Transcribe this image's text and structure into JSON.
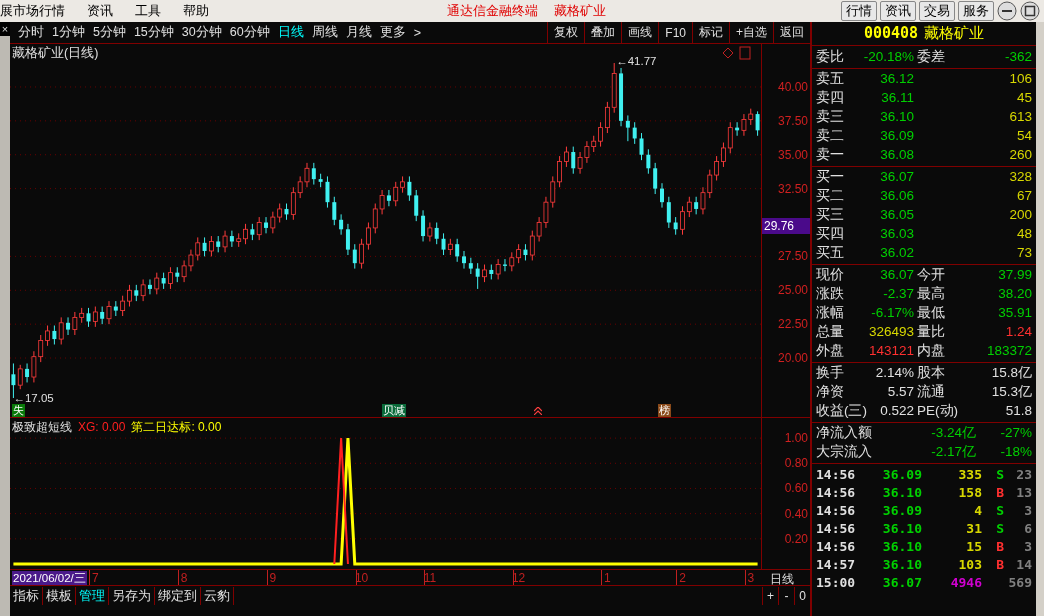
{
  "menu_bar": {
    "items": [
      "展市场行情",
      "资讯",
      "工具",
      "帮助"
    ],
    "app_title": "通达信金融终端",
    "stock_title": "藏格矿业",
    "buttons": [
      "行情",
      "资讯",
      "交易",
      "服务"
    ]
  },
  "close_mark": "×",
  "period_tabs": [
    {
      "label": "分时",
      "selected": false
    },
    {
      "label": "1分钟",
      "selected": false
    },
    {
      "label": "5分钟",
      "selected": false
    },
    {
      "label": "15分钟",
      "selected": false
    },
    {
      "label": "30分钟",
      "selected": false
    },
    {
      "label": "60分钟",
      "selected": false
    },
    {
      "label": "日线",
      "selected": true
    },
    {
      "label": "周线",
      "selected": false
    },
    {
      "label": "月线",
      "selected": false
    },
    {
      "label": "更多",
      "selected": false
    }
  ],
  "more_arrow": ">",
  "tool_buttons": [
    "复权",
    "叠加",
    "画线",
    "F10",
    "标记",
    "+自选",
    "返回"
  ],
  "main_chart": {
    "title": "藏格矿业(日线)",
    "high_label": "←41.77",
    "low_label": "←17.05",
    "current_price": "29.76",
    "event_tags": [
      {
        "kind": "badge",
        "text": "失",
        "color": "#0a7a0a"
      },
      {
        "kind": "badge",
        "text": "贝减",
        "color": "#0a6a3a"
      },
      {
        "kind": "arrow"
      },
      {
        "kind": "badge",
        "text": "榜",
        "color": "#8a4a1a"
      }
    ],
    "chart_data": {
      "type": "candlestick",
      "ylim": [
        15.65,
        43.17
      ],
      "yticks": [
        {
          "value": 40,
          "label": "40.00"
        },
        {
          "value": 37.5,
          "label": "37.50"
        },
        {
          "value": 35,
          "label": "35.00"
        },
        {
          "value": 32.5,
          "label": "32.50"
        },
        {
          "value": 27.5,
          "label": "27.50"
        },
        {
          "value": 25,
          "label": "25.00"
        },
        {
          "value": 22.5,
          "label": "22.50"
        },
        {
          "value": 20,
          "label": "20.00"
        }
      ],
      "grid": true,
      "categories": [
        null,
        null,
        null,
        null,
        null,
        null,
        null,
        null,
        null,
        null,
        null,
        null,
        null,
        null,
        null,
        null,
        null,
        null,
        null,
        null,
        null,
        null,
        null,
        null,
        null,
        null,
        null,
        null,
        null,
        null,
        null,
        null,
        null,
        null,
        null,
        null,
        null,
        null,
        null,
        null,
        null,
        null,
        null,
        null,
        null,
        null,
        null,
        null,
        null,
        null,
        null,
        null,
        null,
        null,
        null,
        null,
        null,
        null,
        null,
        null,
        null,
        null,
        null,
        null,
        null,
        null,
        null,
        null,
        null,
        null,
        null,
        null,
        null,
        null,
        null,
        null,
        null,
        null,
        null,
        null,
        null,
        null,
        null,
        null,
        null,
        null,
        null,
        null,
        null,
        null,
        null,
        null,
        null,
        null,
        null,
        null,
        null,
        null,
        null,
        null,
        null,
        null,
        null,
        null,
        null,
        null,
        null,
        null,
        null,
        null
      ],
      "ohlc": [
        [
          18.8,
          19.6,
          17.05,
          18.0
        ],
        [
          18.0,
          19.5,
          17.7,
          19.2
        ],
        [
          19.2,
          19.6,
          18.2,
          18.6
        ],
        [
          18.6,
          20.5,
          18.2,
          20.1
        ],
        [
          20.1,
          21.7,
          19.7,
          21.3
        ],
        [
          21.3,
          22.4,
          20.9,
          22.0
        ],
        [
          22.0,
          22.4,
          21.0,
          21.4
        ],
        [
          21.4,
          23.0,
          21.0,
          22.6
        ],
        [
          22.6,
          23.0,
          21.7,
          22.1
        ],
        [
          22.1,
          23.4,
          21.7,
          23.0
        ],
        [
          23.0,
          23.7,
          22.6,
          23.3
        ],
        [
          23.3,
          23.7,
          22.3,
          22.7
        ],
        [
          22.7,
          23.8,
          22.3,
          23.4
        ],
        [
          23.4,
          23.8,
          22.5,
          22.9
        ],
        [
          22.9,
          24.2,
          22.5,
          23.8
        ],
        [
          23.8,
          24.2,
          23.1,
          23.5
        ],
        [
          23.5,
          24.6,
          23.1,
          24.2
        ],
        [
          24.2,
          25.4,
          23.8,
          25.0
        ],
        [
          25.0,
          25.4,
          24.2,
          24.6
        ],
        [
          24.6,
          25.8,
          24.2,
          25.4
        ],
        [
          25.4,
          25.8,
          24.7,
          25.1
        ],
        [
          25.1,
          26.3,
          24.7,
          25.9
        ],
        [
          25.9,
          26.3,
          25.1,
          25.5
        ],
        [
          25.5,
          26.7,
          25.1,
          26.3
        ],
        [
          26.3,
          26.7,
          25.6,
          26.0
        ],
        [
          26.0,
          27.2,
          25.6,
          26.8
        ],
        [
          26.8,
          28.0,
          26.4,
          27.6
        ],
        [
          27.6,
          28.9,
          27.2,
          28.5
        ],
        [
          28.5,
          28.9,
          27.5,
          27.9
        ],
        [
          27.9,
          29.0,
          27.5,
          28.6
        ],
        [
          28.6,
          29.0,
          27.8,
          28.2
        ],
        [
          28.2,
          29.4,
          27.8,
          29.0
        ],
        [
          29.0,
          29.4,
          28.2,
          28.6
        ],
        [
          28.6,
          29.2,
          28.2,
          28.8
        ],
        [
          28.8,
          29.9,
          28.4,
          29.5
        ],
        [
          29.5,
          29.9,
          28.7,
          29.1
        ],
        [
          29.1,
          30.4,
          28.7,
          30.0
        ],
        [
          30.0,
          30.4,
          29.2,
          29.6
        ],
        [
          29.6,
          30.8,
          29.2,
          30.4
        ],
        [
          30.4,
          31.4,
          30.0,
          31.0
        ],
        [
          31.0,
          31.4,
          30.2,
          30.6
        ],
        [
          30.6,
          32.6,
          30.2,
          32.2
        ],
        [
          32.2,
          33.4,
          31.8,
          33.0
        ],
        [
          33.0,
          34.4,
          32.6,
          34.0
        ],
        [
          34.0,
          34.4,
          32.8,
          33.2
        ],
        [
          33.2,
          33.6,
          32.6,
          33.0
        ],
        [
          33.0,
          33.4,
          31.1,
          31.5
        ],
        [
          31.5,
          31.9,
          29.8,
          30.2
        ],
        [
          30.2,
          30.6,
          29.1,
          29.5
        ],
        [
          29.5,
          29.9,
          27.6,
          28.0
        ],
        [
          28.0,
          28.4,
          26.6,
          27.0
        ],
        [
          27.0,
          28.8,
          26.6,
          28.4
        ],
        [
          28.4,
          30.0,
          28.0,
          29.6
        ],
        [
          29.6,
          31.4,
          29.2,
          31.0
        ],
        [
          31.0,
          32.4,
          30.6,
          32.0
        ],
        [
          32.0,
          32.4,
          31.2,
          31.6
        ],
        [
          31.6,
          33.0,
          31.2,
          32.6
        ],
        [
          32.6,
          33.4,
          32.2,
          33.0
        ],
        [
          33.0,
          33.4,
          31.6,
          32.0
        ],
        [
          32.0,
          32.4,
          30.1,
          30.5
        ],
        [
          30.5,
          30.9,
          28.6,
          29.0
        ],
        [
          29.0,
          30.0,
          28.6,
          29.6
        ],
        [
          29.6,
          30.0,
          28.4,
          28.8
        ],
        [
          28.8,
          29.2,
          27.6,
          28.0
        ],
        [
          28.0,
          28.8,
          27.6,
          28.4
        ],
        [
          28.4,
          28.8,
          27.1,
          27.5
        ],
        [
          27.5,
          27.9,
          26.6,
          27.0
        ],
        [
          27.0,
          27.4,
          26.2,
          26.6
        ],
        [
          26.6,
          27.0,
          25.1,
          26.0
        ],
        [
          26.0,
          26.9,
          25.6,
          26.5
        ],
        [
          26.5,
          26.9,
          25.8,
          26.2
        ],
        [
          26.2,
          27.3,
          25.8,
          26.9
        ],
        [
          26.9,
          27.3,
          26.4,
          26.8
        ],
        [
          26.8,
          27.8,
          26.4,
          27.4
        ],
        [
          27.4,
          28.4,
          27.0,
          28.0
        ],
        [
          28.0,
          28.4,
          27.2,
          27.6
        ],
        [
          27.6,
          29.4,
          27.2,
          29.0
        ],
        [
          29.0,
          30.4,
          28.6,
          30.0
        ],
        [
          30.0,
          31.9,
          29.6,
          31.5
        ],
        [
          31.5,
          33.4,
          31.1,
          33.0
        ],
        [
          33.0,
          34.9,
          32.6,
          34.5
        ],
        [
          34.5,
          35.6,
          34.1,
          35.2
        ],
        [
          35.2,
          35.6,
          33.6,
          34.0
        ],
        [
          34.0,
          35.2,
          33.6,
          34.8
        ],
        [
          34.8,
          36.0,
          34.4,
          35.6
        ],
        [
          35.6,
          36.4,
          35.2,
          36.0
        ],
        [
          36.0,
          37.4,
          35.6,
          37.0
        ],
        [
          37.0,
          38.9,
          36.6,
          38.5
        ],
        [
          38.5,
          41.77,
          38.1,
          41.0
        ],
        [
          41.0,
          41.4,
          37.1,
          37.5
        ],
        [
          37.5,
          37.9,
          36.0,
          37.0
        ],
        [
          37.0,
          37.4,
          35.8,
          36.2
        ],
        [
          36.2,
          36.6,
          34.6,
          35.0
        ],
        [
          35.0,
          35.4,
          33.6,
          34.0
        ],
        [
          34.0,
          34.4,
          32.1,
          32.5
        ],
        [
          32.5,
          32.9,
          31.1,
          31.5
        ],
        [
          31.5,
          31.9,
          29.6,
          30.0
        ],
        [
          30.0,
          30.4,
          29.1,
          29.5
        ],
        [
          29.5,
          31.2,
          29.1,
          30.8
        ],
        [
          30.8,
          31.9,
          30.4,
          31.5
        ],
        [
          31.5,
          31.9,
          30.6,
          31.0
        ],
        [
          31.0,
          32.6,
          30.6,
          32.2
        ],
        [
          32.2,
          33.9,
          31.8,
          33.5
        ],
        [
          33.5,
          34.9,
          33.1,
          34.5
        ],
        [
          34.5,
          35.9,
          34.1,
          35.5
        ],
        [
          35.5,
          37.4,
          35.1,
          37.0
        ],
        [
          37.0,
          37.4,
          36.4,
          36.8
        ],
        [
          36.8,
          38.0,
          36.4,
          37.6
        ],
        [
          37.6,
          38.4,
          37.2,
          38.0
        ],
        [
          38.0,
          38.2,
          36.4,
          36.8
        ]
      ]
    }
  },
  "indicator": {
    "name": "极致超短线",
    "readings": [
      ": 0.00",
      ": 0.00"
    ],
    "chart_data": {
      "type": "line",
      "ylim": [
        -0.04,
        1.16
      ],
      "yticks": [
        {
          "value": 1,
          "label": "1.00"
        },
        {
          "value": 0.8,
          "label": "0.80"
        },
        {
          "value": 0.6,
          "label": "0.60"
        },
        {
          "value": 0.4,
          "label": "0.40"
        },
        {
          "value": 0.2,
          "label": "0.20"
        }
      ],
      "grid": true,
      "categories": [
        null,
        null,
        null,
        null,
        null,
        null,
        null,
        null,
        null,
        null,
        null,
        null,
        "7",
        null,
        null,
        null,
        null,
        null,
        null,
        null,
        null,
        null,
        null,
        null,
        null,
        "8",
        null,
        null,
        null,
        null,
        null,
        null,
        null,
        null,
        null,
        null,
        null,
        null,
        "9",
        null,
        null,
        null,
        null,
        null,
        null,
        null,
        null,
        null,
        null,
        null,
        null,
        "10",
        null,
        null,
        null,
        null,
        null,
        null,
        null,
        null,
        null,
        "11",
        null,
        null,
        null,
        null,
        null,
        null,
        null,
        null,
        null,
        null,
        null,
        null,
        "12",
        null,
        null,
        null,
        null,
        null,
        null,
        null,
        null,
        null,
        null,
        null,
        null,
        "1",
        null,
        null,
        null,
        null,
        null,
        null,
        null,
        null,
        null,
        null,
        "2",
        null,
        null,
        null,
        null,
        null,
        null,
        null,
        null,
        null,
        "3",
        null
      ],
      "series": [
        {
          "name": "XG",
          "color": "#ff2020",
          "values": [
            null,
            null,
            null,
            null,
            null,
            null,
            null,
            null,
            null,
            null,
            null,
            null,
            null,
            null,
            null,
            null,
            null,
            null,
            null,
            null,
            null,
            null,
            null,
            null,
            null,
            null,
            null,
            null,
            null,
            null,
            null,
            null,
            null,
            null,
            null,
            null,
            null,
            null,
            null,
            null,
            null,
            null,
            null,
            null,
            null,
            null,
            null,
            0,
            1,
            0,
            null,
            null,
            null,
            null,
            null,
            null,
            null,
            null,
            null,
            null,
            null,
            null,
            null,
            null,
            null,
            null,
            null,
            null,
            null,
            null,
            null,
            null,
            null,
            null,
            null,
            null,
            null,
            null,
            null,
            null,
            null,
            null,
            null,
            null,
            null,
            null,
            null,
            null,
            null,
            null,
            null,
            null,
            null,
            null,
            null,
            null,
            null,
            null,
            null,
            null,
            null,
            null,
            null,
            null,
            null,
            null,
            null,
            null,
            null,
            null
          ]
        },
        {
          "name": "第二日达标",
          "color": "#ffff00",
          "values": [
            0,
            0,
            0,
            0,
            0,
            0,
            0,
            0,
            0,
            0,
            0,
            0,
            0,
            0,
            0,
            0,
            0,
            0,
            0,
            0,
            0,
            0,
            0,
            0,
            0,
            0,
            0,
            0,
            0,
            0,
            0,
            0,
            0,
            0,
            0,
            0,
            0,
            0,
            0,
            0,
            0,
            0,
            0,
            0,
            0,
            0,
            0,
            0,
            0,
            1,
            0,
            0,
            0,
            0,
            0,
            0,
            0,
            0,
            0,
            0,
            0,
            0,
            0,
            0,
            0,
            0,
            0,
            0,
            0,
            0,
            0,
            0,
            0,
            0,
            0,
            0,
            0,
            0,
            0,
            0,
            0,
            0,
            0,
            0,
            0,
            0,
            0,
            0,
            0,
            0,
            0,
            0,
            0,
            0,
            0,
            0,
            0,
            0,
            0,
            0,
            0,
            0,
            0,
            0,
            0,
            0,
            0,
            0,
            0,
            0
          ]
        }
      ]
    }
  },
  "date_axis": {
    "cursor_date": "2021/06/02/三",
    "period": "日线"
  },
  "bottom_tabs": [
    {
      "label": "指标",
      "selected": false
    },
    {
      "label": "模板",
      "selected": false
    },
    {
      "label": "管理",
      "selected": true
    },
    {
      "label": "另存为",
      "selected": false
    },
    {
      "label": "绑定到",
      "selected": false
    },
    {
      "label": "云豹",
      "selected": false
    }
  ],
  "zoom_buttons": [
    "+",
    "-",
    "0"
  ],
  "quote": {
    "code": "000408",
    "name": "藏格矿业",
    "ratio": {
      "label": "委比",
      "value": "-20.18%",
      "label2": "委差",
      "value2": "-362"
    },
    "asks": [
      {
        "label": "卖五",
        "price": "36.12",
        "volume": "106"
      },
      {
        "label": "卖四",
        "price": "36.11",
        "volume": "45"
      },
      {
        "label": "卖三",
        "price": "36.10",
        "volume": "613"
      },
      {
        "label": "卖二",
        "price": "36.09",
        "volume": "54"
      },
      {
        "label": "卖一",
        "price": "36.08",
        "volume": "260"
      }
    ],
    "bids": [
      {
        "label": "买一",
        "price": "36.07",
        "volume": "328"
      },
      {
        "label": "买二",
        "price": "36.06",
        "volume": "67"
      },
      {
        "label": "买三",
        "price": "36.05",
        "volume": "200"
      },
      {
        "label": "买四",
        "price": "36.03",
        "volume": "48"
      },
      {
        "label": "买五",
        "price": "36.02",
        "volume": "73"
      }
    ],
    "stats": [
      {
        "cells": [
          {
            "label": "现价",
            "value": "36.07",
            "color": "#00d000"
          },
          {
            "label": "今开",
            "value": "37.99",
            "color": "#00d000"
          }
        ]
      },
      {
        "cells": [
          {
            "label": "涨跌",
            "value": "-2.37",
            "color": "#00d000"
          },
          {
            "label": "最高",
            "value": "38.20",
            "color": "#00d000"
          }
        ]
      },
      {
        "cells": [
          {
            "label": "涨幅",
            "value": "-6.17%",
            "color": "#00d000"
          },
          {
            "label": "最低",
            "value": "35.91",
            "color": "#00d000"
          }
        ]
      },
      {
        "cells": [
          {
            "label": "总量",
            "value": "326493",
            "color": "#d8d800"
          },
          {
            "label": "量比",
            "value": "1.24",
            "color": "#ff3030"
          }
        ]
      },
      {
        "cells": [
          {
            "label": "外盘",
            "value": "143121",
            "color": "#ff3030"
          },
          {
            "label": "内盘",
            "value": "183372",
            "color": "#00d000"
          }
        ]
      }
    ],
    "fundamentals": [
      {
        "label": "换手",
        "value": "2.14%",
        "label2": "股本",
        "value2": "15.8亿"
      },
      {
        "label": "净资",
        "value": "5.57",
        "label2": "流通",
        "value2": "15.3亿"
      },
      {
        "label": "收益(三)",
        "value": "0.522",
        "label2": "PE(动)",
        "value2": "51.8"
      }
    ],
    "flows": [
      {
        "label": "净流入额",
        "amount": "-3.24亿",
        "percent": "-27%"
      },
      {
        "label": "大宗流入",
        "amount": "-2.17亿",
        "percent": "-18%"
      }
    ],
    "trades": [
      {
        "kind": "sell",
        "time": "14:56",
        "price": "36.09",
        "volume": "335",
        "side": "S",
        "count": "23"
      },
      {
        "kind": "buy",
        "time": "14:56",
        "price": "36.10",
        "volume": "158",
        "side": "B",
        "count": "13"
      },
      {
        "kind": "sell",
        "time": "14:56",
        "price": "36.09",
        "volume": "4",
        "side": "S",
        "count": "3"
      },
      {
        "kind": "sell",
        "time": "14:56",
        "price": "36.10",
        "volume": "31",
        "side": "S",
        "count": "6"
      },
      {
        "kind": "buy",
        "time": "14:56",
        "price": "36.10",
        "volume": "15",
        "side": "B",
        "count": "3"
      },
      {
        "kind": "buy",
        "time": "14:57",
        "price": "36.10",
        "volume": "103",
        "side": "B",
        "count": "14"
      },
      {
        "kind": "closing",
        "time": "15:00",
        "price": "36.07",
        "volume": "4946",
        "count": "569"
      }
    ]
  }
}
